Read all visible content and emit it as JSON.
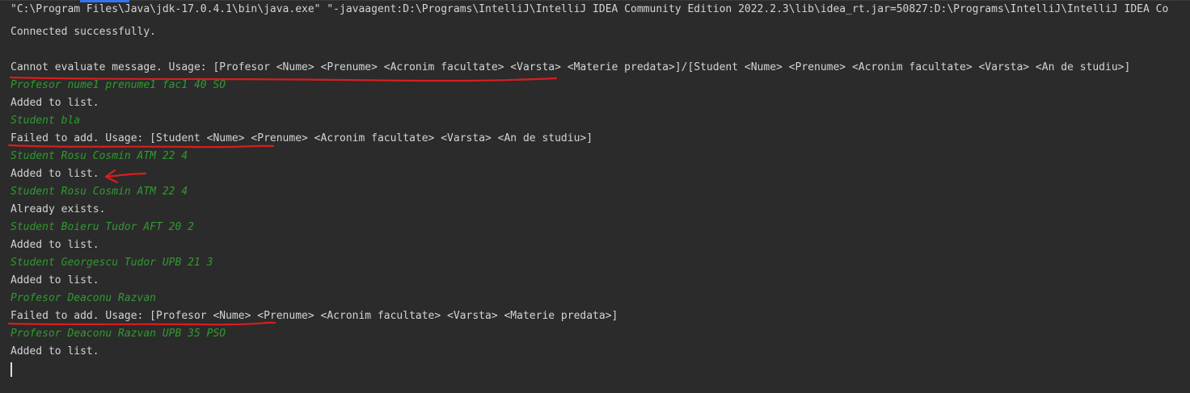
{
  "console": {
    "lines": [
      {
        "text": "\"C:\\Program Files\\Java\\jdk-17.0.4.1\\bin\\java.exe\" \"-javaagent:D:\\Programs\\IntelliJ\\IntelliJ IDEA Community Edition 2022.2.3\\lib\\idea_rt.jar=50827:D:\\Programs\\IntelliJ\\IntelliJ IDEA Co",
        "kind": "command"
      },
      {
        "text": "Connected successfully.",
        "kind": "output"
      },
      {
        "text": "",
        "kind": "output"
      },
      {
        "text": "Cannot evaluate message. Usage: [Profesor <Nume> <Prenume> <Acronim facultate> <Varsta> <Materie predata>]/[Student <Nume> <Prenume> <Acronim facultate> <Varsta> <An de studiu>]",
        "kind": "output"
      },
      {
        "text": "Profesor nume1 prenume1 fac1 40 SO",
        "kind": "input"
      },
      {
        "text": "Added to list.",
        "kind": "output"
      },
      {
        "text": "Student bla",
        "kind": "input"
      },
      {
        "text": "Failed to add. Usage: [Student <Nume> <Prenume> <Acronim facultate> <Varsta> <An de studiu>]",
        "kind": "output"
      },
      {
        "text": "Student Rosu Cosmin ATM 22 4",
        "kind": "input"
      },
      {
        "text": "Added to list.",
        "kind": "output"
      },
      {
        "text": "Student Rosu Cosmin ATM 22 4",
        "kind": "input"
      },
      {
        "text": "Already exists.",
        "kind": "output"
      },
      {
        "text": "Student Boieru Tudor AFT 20 2",
        "kind": "input"
      },
      {
        "text": "Added to list.",
        "kind": "output"
      },
      {
        "text": "Student Georgescu Tudor UPB 21 3",
        "kind": "input"
      },
      {
        "text": "Added to list.",
        "kind": "output"
      },
      {
        "text": "Profesor Deaconu Razvan",
        "kind": "input"
      },
      {
        "text": "Failed to add. Usage: [Profesor <Nume> <Prenume> <Acronim facultate> <Varsta> <Materie predata>]",
        "kind": "output"
      },
      {
        "text": "Profesor Deaconu Razvan UPB 35 PSO",
        "kind": "input"
      },
      {
        "text": "Added to list.",
        "kind": "output"
      }
    ]
  },
  "colors": {
    "background": "#2b2b2b",
    "output_text": "#d4d4d4",
    "user_input_text": "#2f9a2f",
    "annotation_red": "#d81e1e",
    "tab_accent": "#3574f0"
  },
  "annotations": {
    "underlines": [
      "line-3",
      "line-7",
      "line-17"
    ],
    "arrow_icon": "arrow-pointing-left-icon"
  }
}
